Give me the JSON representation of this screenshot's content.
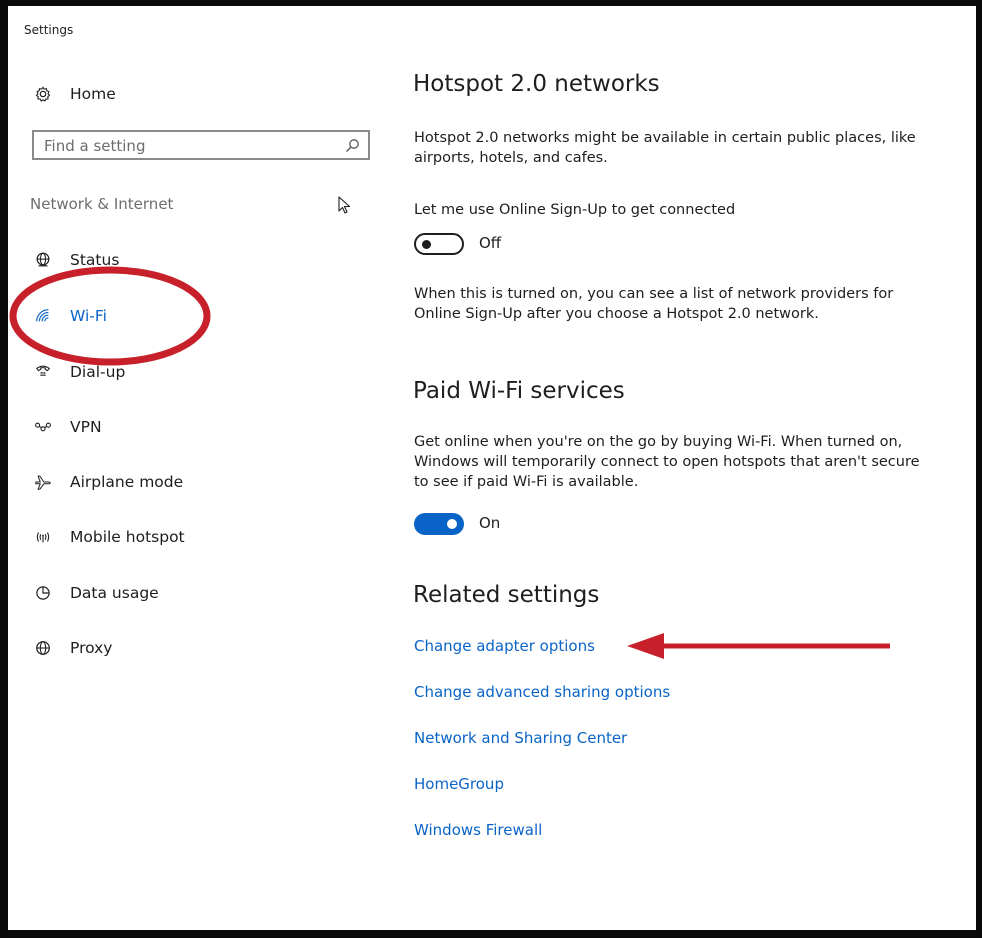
{
  "window": {
    "title": "Settings"
  },
  "sidebar": {
    "home_label": "Home",
    "search_placeholder": "Find a setting",
    "section_label": "Network & Internet",
    "items": [
      {
        "label": "Status",
        "icon": "globe-icon"
      },
      {
        "label": "Wi-Fi",
        "icon": "wifi-icon",
        "active": true
      },
      {
        "label": "Dial-up",
        "icon": "phone-icon"
      },
      {
        "label": "VPN",
        "icon": "vpn-icon"
      },
      {
        "label": "Airplane mode",
        "icon": "airplane-icon"
      },
      {
        "label": "Mobile hotspot",
        "icon": "hotspot-icon"
      },
      {
        "label": "Data usage",
        "icon": "pie-chart-icon"
      },
      {
        "label": "Proxy",
        "icon": "globe-icon"
      }
    ]
  },
  "main": {
    "hotspot": {
      "heading": "Hotspot 2.0 networks",
      "description": "Hotspot 2.0 networks might be available in certain public places, like airports, hotels, and cafes.",
      "toggle_caption": "Let me use Online Sign-Up to get connected",
      "toggle_state": "Off",
      "note": "When this is turned on, you can see a list of network providers for Online Sign-Up after you choose a Hotspot 2.0 network."
    },
    "paid": {
      "heading": "Paid Wi-Fi services",
      "description": "Get online when you're on the go by buying Wi-Fi. When turned on, Windows will temporarily connect to open hotspots that aren't secure to see if paid Wi-Fi is available.",
      "toggle_state": "On"
    },
    "related": {
      "heading": "Related settings",
      "links": [
        "Change adapter options",
        "Change advanced sharing options",
        "Network and Sharing Center",
        "HomeGroup",
        "Windows Firewall"
      ]
    }
  },
  "colors": {
    "accent": "#0a64c8",
    "annotation": "#c8202a",
    "text": "#1e1e1e"
  }
}
